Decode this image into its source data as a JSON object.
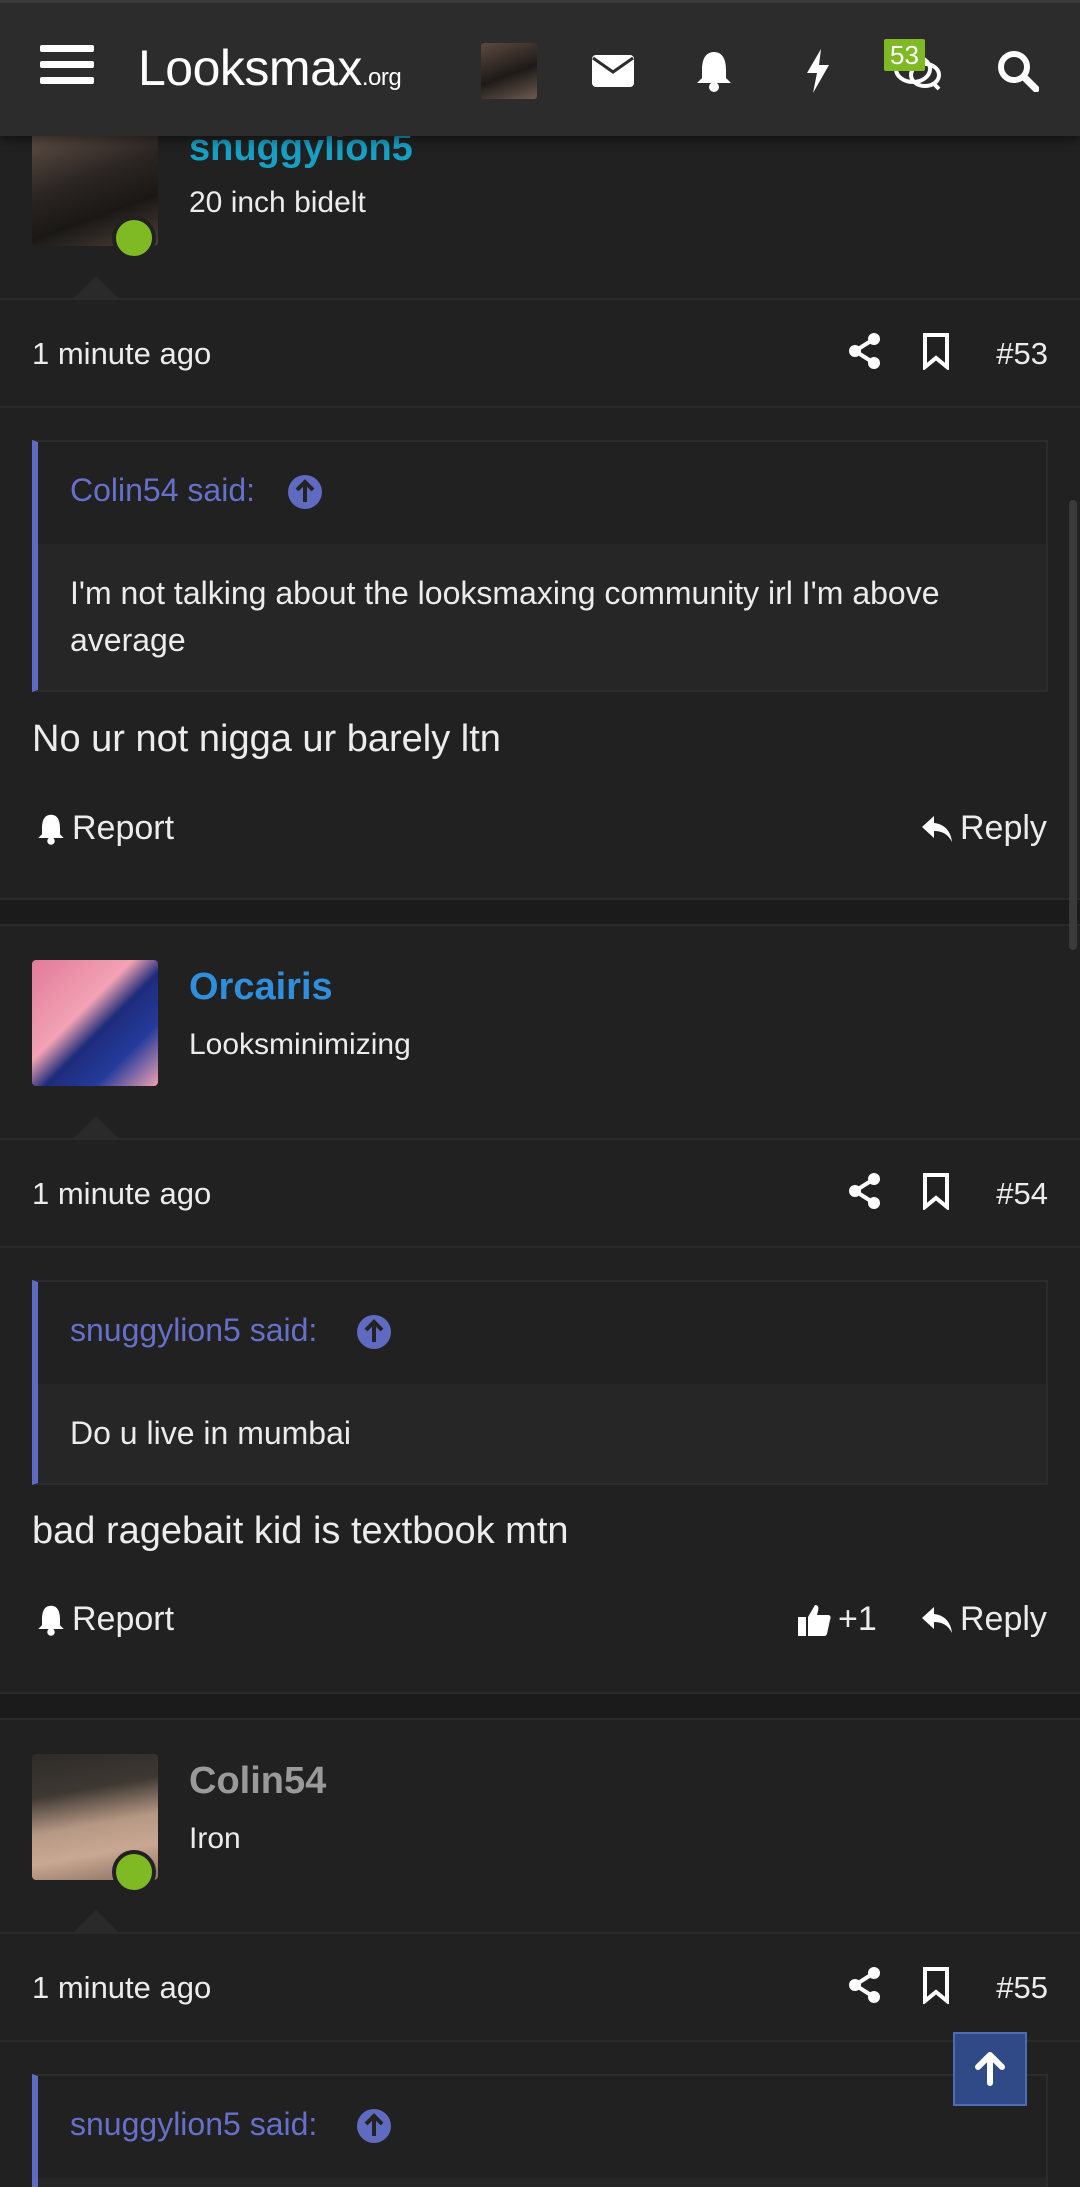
{
  "header": {
    "logo_text": "Looksmax",
    "logo_suffix": ".org",
    "conversations_badge": "53"
  },
  "posts": [
    {
      "username": "snuggylion5",
      "username_color": "#17a0c3",
      "user_title": "20 inch bidelt",
      "online": true,
      "time": "1 minute ago",
      "post_number": "#53",
      "quote_author": "Colin54 said:",
      "quote_text": "I'm not talking about the looksmaxing community irl I'm above average",
      "body": "No ur not nigga ur barely ltn",
      "report_label": "Report",
      "reply_label": "Reply"
    },
    {
      "username": "Orcairis",
      "username_color": "#2f8fdc",
      "user_title": "Looksminimizing",
      "online": false,
      "time": "1 minute ago",
      "post_number": "#54",
      "quote_author": "snuggylion5 said:",
      "quote_text": "Do u live in mumbai",
      "body": "bad ragebait kid is textbook mtn",
      "report_label": "Report",
      "like_count": "+1",
      "reply_label": "Reply"
    },
    {
      "username": "Colin54",
      "username_color": "#9a9a9a",
      "user_title": "Iron",
      "online": true,
      "time": "1 minute ago",
      "post_number": "#55",
      "quote_author": "snuggylion5 said:"
    }
  ],
  "colors": {
    "background": "#212121",
    "quote_accent": "#5f6bc1",
    "online": "#7fba24",
    "scroll_top": "#2f4a87"
  }
}
